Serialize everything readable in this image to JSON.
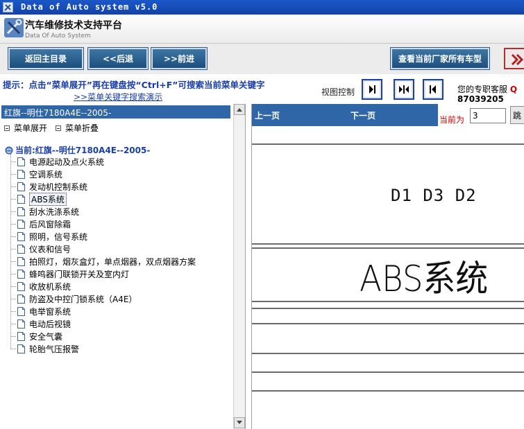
{
  "window": {
    "title": "Data of Auto system v5.0"
  },
  "header": {
    "title": "汽车维修技术支持平台",
    "subtitle": "Data Of Auto System"
  },
  "toolbar": {
    "back_main": "返回主目录",
    "back": "<<后退",
    "forward": ">>前进",
    "view_all_models": "查看当前厂家所有车型"
  },
  "hint": {
    "text": "提示：点击“菜单展开”再在键盘按“Ctrl+F”可搜索当前菜单关键字",
    "demo_link": ">>菜单关键字搜索演示"
  },
  "view_control": {
    "label": "视图控制"
  },
  "service": {
    "label": "您的专职客服",
    "q_prefix": "Q",
    "phone": "87039205"
  },
  "left": {
    "vehicle_title": "红旗--明仕7180A4E--2005-",
    "expand": "菜单展开",
    "collapse": "菜单折叠",
    "root": "当前:红旗--明仕7180A4E--2005-",
    "items": [
      "电源起动及点火系统",
      "空调系统",
      "发动机控制系统",
      "ABS系统",
      "刮水洗涤系统",
      "后风窗除霜",
      "照明，信号系统",
      "仪表和信号",
      "拍照灯，烟灰盒灯，单点烟器，双点烟器方案",
      "蜂鸣器门联锁开关及室内灯",
      "收放机系统",
      "防盗及中控门锁系统（A4E）",
      "电举窗系统",
      "电动后视镜",
      "安全气囊",
      "轮胎气压报警"
    ],
    "selected_index": 3
  },
  "right": {
    "prev": "上一页",
    "next": "下一页",
    "page_label": "当前为",
    "page_value": "3",
    "jump": "跳",
    "doc_codes": "D1 D3 D2",
    "doc_title": "ABS系统"
  }
}
